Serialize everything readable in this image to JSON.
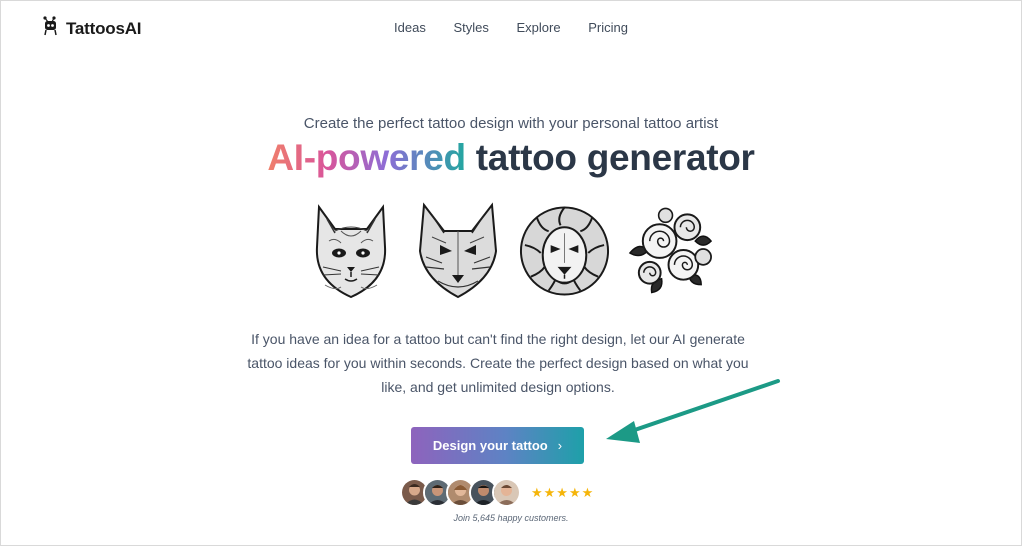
{
  "brand": {
    "name": "TattoosAI",
    "icon": "robot-icon"
  },
  "nav": {
    "items": [
      "Ideas",
      "Styles",
      "Explore",
      "Pricing"
    ]
  },
  "hero": {
    "subtitle": "Create the perfect tattoo design with your personal tattoo artist",
    "headline_gradient": "AI-powered",
    "headline_rest": " tattoo generator",
    "gradient_colors": [
      "#f0806a",
      "#d9559a",
      "#8d6dd6",
      "#22a7a0"
    ],
    "gallery": [
      "cat-tattoo-image",
      "wolf-tattoo-image",
      "lion-tattoo-image",
      "roses-tattoo-image"
    ],
    "description": "If you have an idea for a tattoo but can't find the right design, let our AI generate tattoo ideas for you within seconds. Create the perfect design based on what you like, and get unlimited design options.",
    "cta_label": "Design your tattoo",
    "cta_icon": "chevron-right-icon",
    "cta_colors": [
      "#8e63bd",
      "#1ea0a9"
    ]
  },
  "social_proof": {
    "avatars": [
      "avatar-1",
      "avatar-2",
      "avatar-3",
      "avatar-4",
      "avatar-5"
    ],
    "rating_stars": 5,
    "stars": "★★★★★",
    "caption": "Join 5,645 happy customers."
  },
  "annotation": {
    "arrow_color": "#1c9a86"
  }
}
